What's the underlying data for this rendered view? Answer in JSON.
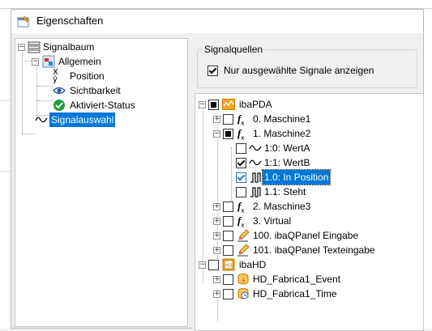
{
  "dialog": {
    "title": "Eigenschaften"
  },
  "left_tree": {
    "root": "Signalbaum",
    "general": "Allgemein",
    "items": [
      "Position",
      "Sichtbarkeit",
      "Aktiviert-Status"
    ],
    "selected": "Signalauswahl"
  },
  "sources": {
    "group_title": "Signalquellen",
    "checkbox_label": "Nur ausgewählte Signale anzeigen",
    "tree": [
      {
        "label": "ibaPDA"
      },
      {
        "label": "0. Maschine1"
      },
      {
        "label": "1. Maschine2"
      },
      {
        "label": "1:0: WertA"
      },
      {
        "label": "1:1: WertB"
      },
      {
        "label": "1.0: In Position"
      },
      {
        "label": "1.1: Steht"
      },
      {
        "label": "2. Maschine3"
      },
      {
        "label": "3. Virtual"
      },
      {
        "label": "100. ibaQPanel Eingabe"
      },
      {
        "label": "101. ibaQPanel Texteingabe"
      },
      {
        "label": "ibaHD"
      },
      {
        "label": "HD_Fabrica1_Event"
      },
      {
        "label": "HD_Fabrica1_Time"
      }
    ]
  },
  "colors": {
    "selection": "#0078d7",
    "accent_orange": "#f5a623"
  }
}
